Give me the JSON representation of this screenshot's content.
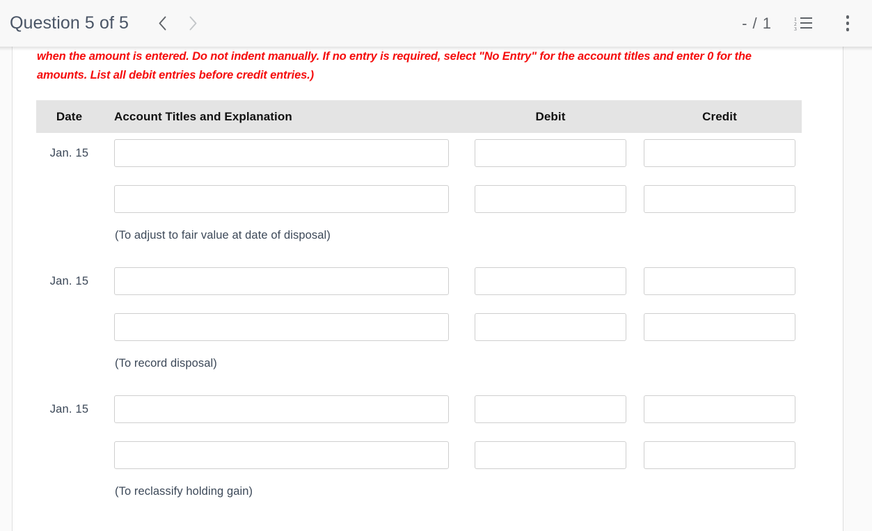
{
  "topbar": {
    "title": "Question 5 of 5",
    "prev_icon": "chevron-left-icon",
    "next_icon": "chevron-right-icon",
    "score": "- / 1",
    "list_icon": "numbered-list-icon",
    "list_numbers": [
      "1",
      "2",
      "3"
    ],
    "menu_icon": "more-vertical-icon"
  },
  "instructions": {
    "text": "when the amount is entered. Do not indent manually. If no entry is required, select \"No Entry\" for the account titles and enter 0 for the amounts. List all debit entries before credit entries.)",
    "color": "#f50d0d"
  },
  "table": {
    "headers": {
      "date": "Date",
      "account": "Account Titles and Explanation",
      "debit": "Debit",
      "credit": "Credit"
    },
    "header_bg": "#e4e4e4",
    "entries": [
      {
        "date": "Jan. 15",
        "lines": [
          {
            "account": "",
            "debit": "",
            "credit": ""
          },
          {
            "account": "",
            "debit": "",
            "credit": ""
          }
        ],
        "explanation": "(To adjust to fair value at date of disposal)"
      },
      {
        "date": "Jan. 15",
        "lines": [
          {
            "account": "",
            "debit": "",
            "credit": ""
          },
          {
            "account": "",
            "debit": "",
            "credit": ""
          }
        ],
        "explanation": "(To record disposal)"
      },
      {
        "date": "Jan. 15",
        "lines": [
          {
            "account": "",
            "debit": "",
            "credit": ""
          },
          {
            "account": "",
            "debit": "",
            "credit": ""
          }
        ],
        "explanation": "(To reclassify holding gain)"
      }
    ]
  }
}
